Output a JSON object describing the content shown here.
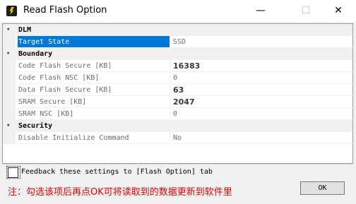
{
  "window": {
    "title": "Read Flash Option",
    "controls": {
      "minimize": "—",
      "maximize": "☐",
      "close": "✕"
    }
  },
  "grid": {
    "categories": [
      {
        "name": "DLM",
        "toggle": "▾",
        "props": [
          {
            "name": "Target State",
            "value": "SSD",
            "selected": true
          }
        ]
      },
      {
        "name": "Boundary",
        "toggle": "▾",
        "props": [
          {
            "name": "Code Flash Secure [KB]",
            "value": "16383",
            "bold": true
          },
          {
            "name": "Code Flash NSC [KB]",
            "value": "0"
          },
          {
            "name": "Data Flash Secure [KB]",
            "value": "63",
            "bold": true
          },
          {
            "name": "SRAM Secure [KB]",
            "value": "2047",
            "bold": true
          },
          {
            "name": "SRAM NSC [KB]",
            "value": "0"
          }
        ]
      },
      {
        "name": "Security",
        "toggle": "▾",
        "props": [
          {
            "name": "Disable Initialize Command",
            "value": "No"
          }
        ]
      }
    ]
  },
  "feedback": {
    "label": "Feedback these settings to [Flash Option] tab",
    "checked": false
  },
  "note": "注：勾选该项后再点OK可将读取到的数据更新到软件里",
  "ok_label": "OK",
  "colors": {
    "selection": "#0078d7",
    "note": "#e60000"
  }
}
